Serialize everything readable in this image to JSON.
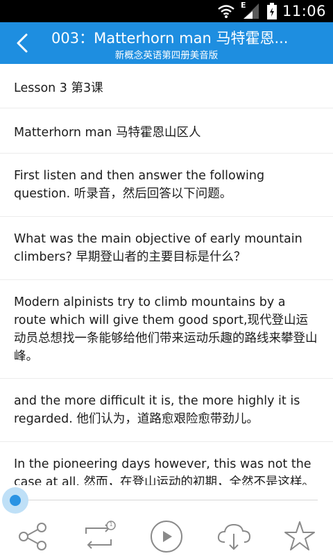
{
  "status_bar": {
    "time": "11:06",
    "network_label": "E",
    "icons": [
      "wifi-icon",
      "cell-signal-icon",
      "battery-icon"
    ]
  },
  "header": {
    "title": "003：Matterhorn man 马特霍恩...",
    "subtitle": "新概念英语第四册美音版",
    "background_color": "#1e8ee0"
  },
  "content": {
    "rows": [
      {
        "text": "Lesson 3  第3课"
      },
      {
        "text": "Matterhorn man  马特霍恩山区人"
      },
      {
        "text": "First listen and then answer the following question. 听录音，然后回答以下问题。"
      },
      {
        "text": "What was the main objective of early mountain climbers? 早期登山者的主要目标是什么？"
      },
      {
        "text": "Modern alpinists try to climb mountains by a route which will give them good sport,现代登山运动员总想找一条能够给他们带来运动乐趣的路线来攀登山峰。"
      },
      {
        "text": "and the more difficult it is, the more highly it is regarded. 他们认为，道路愈艰险愈带劲儿。"
      },
      {
        "text": "In the pioneering days however, this was not the case at all. 然而，在登山运动的初期，全然不是这样。"
      }
    ]
  },
  "player": {
    "progress": 0,
    "accent_color": "#2a93e3",
    "toolbar_icons": [
      "share-icon",
      "repeat-icon",
      "play-icon",
      "download-icon",
      "star-icon"
    ],
    "repeat_badge": "1"
  }
}
